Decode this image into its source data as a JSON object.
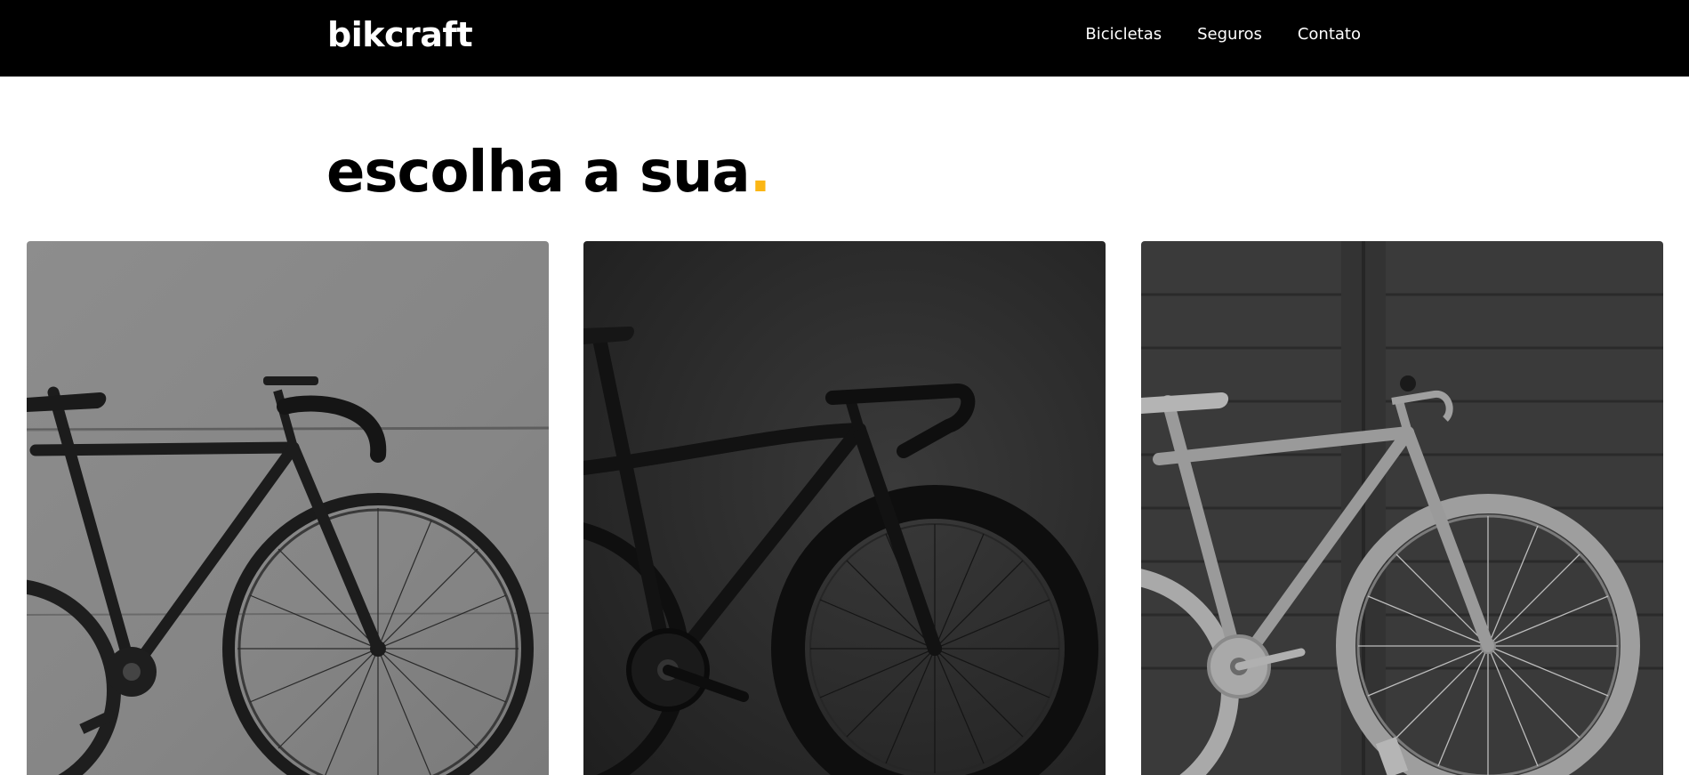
{
  "header": {
    "logo": "bikcraft",
    "nav": [
      "Bicicletas",
      "Seguros",
      "Contato"
    ]
  },
  "main": {
    "title": "escolha a sua",
    "title_accent": "."
  },
  "colors": {
    "header_bg": "#000000",
    "accent": "#fbb614",
    "text": "#000000"
  }
}
